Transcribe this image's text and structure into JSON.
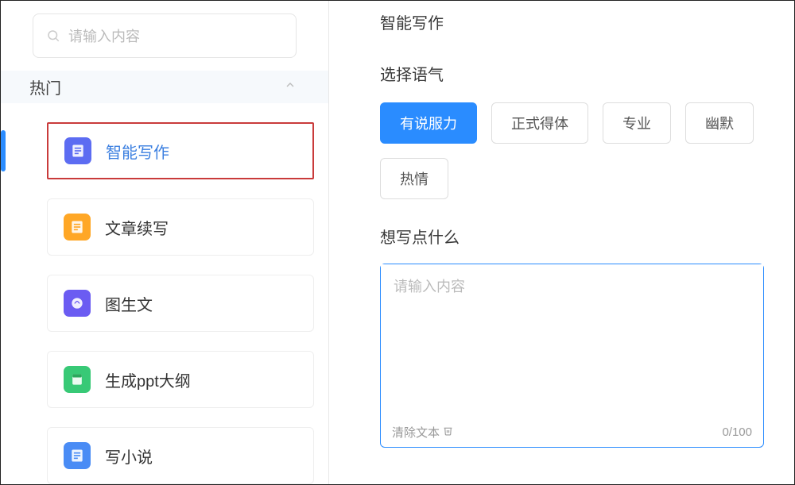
{
  "sidebar": {
    "search_placeholder": "请输入内容",
    "section_title": "热门",
    "items": [
      {
        "label": "智能写作",
        "icon": "doc-icon",
        "color": "blue",
        "active": true
      },
      {
        "label": "文章续写",
        "icon": "doc-icon",
        "color": "orange",
        "active": false
      },
      {
        "label": "图生文",
        "icon": "image-icon",
        "color": "purple",
        "active": false
      },
      {
        "label": "生成ppt大纲",
        "icon": "ppt-icon",
        "color": "green",
        "active": false
      },
      {
        "label": "写小说",
        "icon": "doc-icon",
        "color": "lightblue",
        "active": false
      }
    ]
  },
  "main": {
    "title": "智能写作",
    "tone_section_label": "选择语气",
    "tones": [
      {
        "label": "有说服力",
        "selected": true
      },
      {
        "label": "正式得体",
        "selected": false
      },
      {
        "label": "专业",
        "selected": false
      },
      {
        "label": "幽默",
        "selected": false
      },
      {
        "label": "热情",
        "selected": false
      }
    ],
    "prompt_section_label": "想写点什么",
    "textarea_placeholder": "请输入内容",
    "clear_label": "清除文本",
    "char_count": "0/100"
  }
}
